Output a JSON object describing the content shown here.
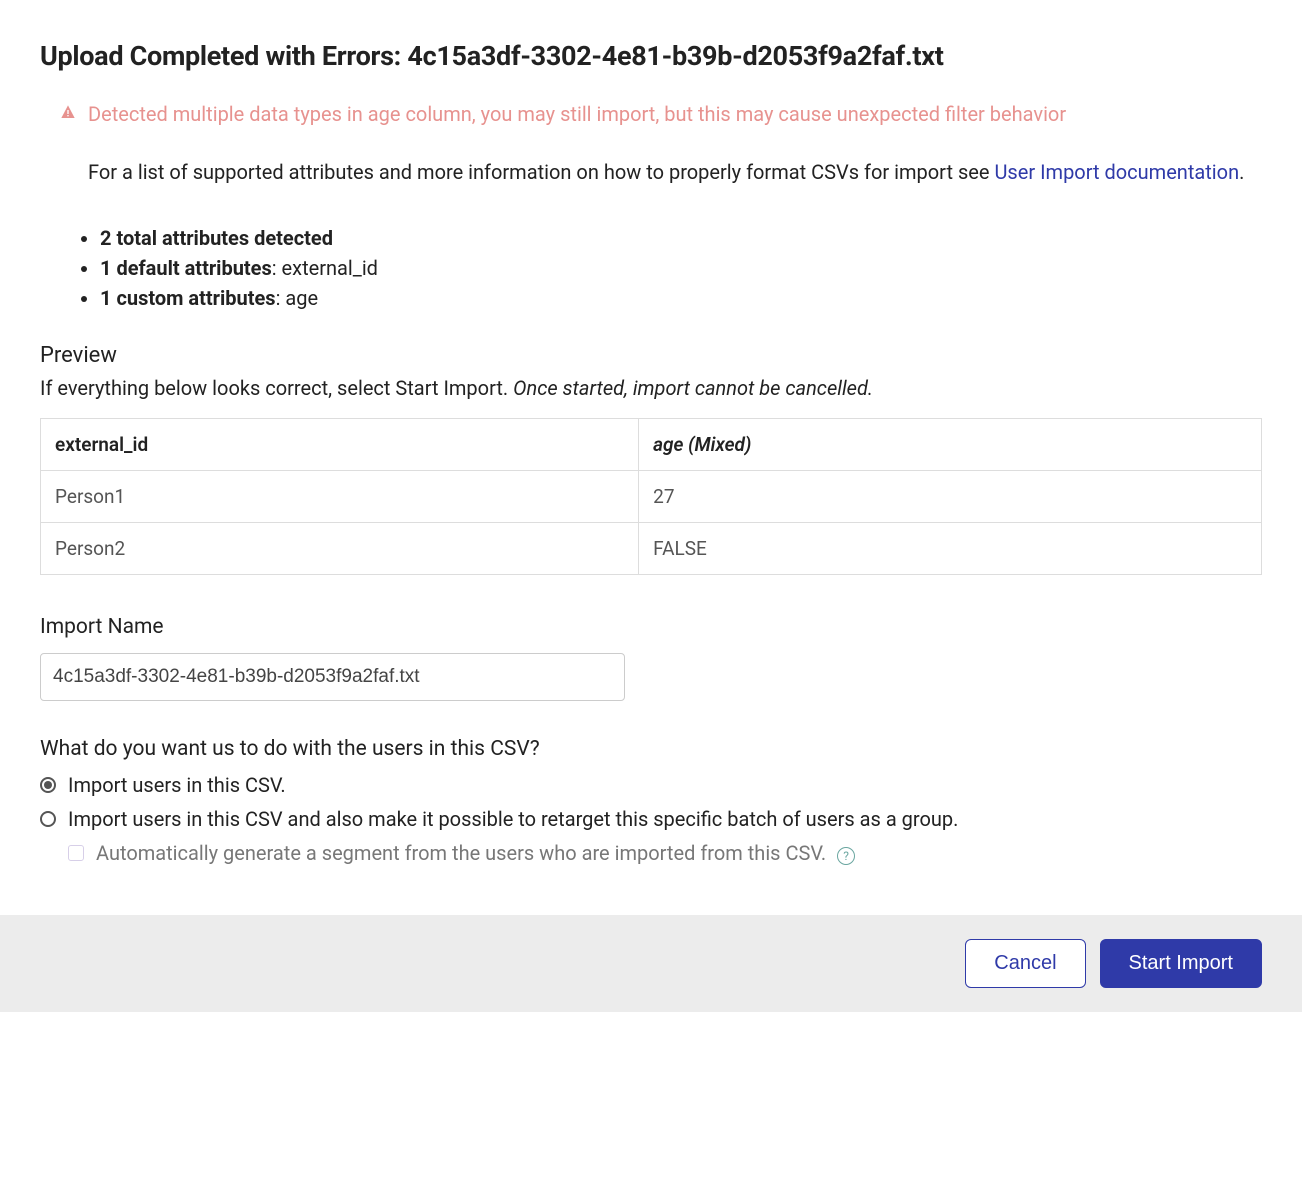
{
  "heading": "Upload Completed with Errors: 4c15a3df-3302-4e81-b39b-d2053f9a2faf.txt",
  "warning": "Detected multiple data types in age column, you may still import, but this may cause unexpected filter behavior",
  "helper_text_pre": "For a list of supported attributes and more information on how to properly format CSVs for import see ",
  "helper_link": "User Import documentation",
  "helper_text_post": ".",
  "bullets": {
    "total": {
      "bold": "2 total attributes detected",
      "rest": ""
    },
    "default": {
      "bold": "1 default attributes",
      "rest": ": external_id"
    },
    "custom": {
      "bold": "1 custom attributes",
      "rest": ": age"
    }
  },
  "preview": {
    "title": "Preview",
    "hint_plain": "If everything below looks correct, select Start Import. ",
    "hint_italic": "Once started, import cannot be cancelled.",
    "columns": [
      "external_id",
      "age (Mixed)"
    ],
    "rows": [
      {
        "external_id": "Person1",
        "age": "27"
      },
      {
        "external_id": "Person2",
        "age": "FALSE"
      }
    ]
  },
  "import_name": {
    "label": "Import Name",
    "value": "4c15a3df-3302-4e81-b39b-d2053f9a2faf.txt"
  },
  "csv_action": {
    "question": "What do you want us to do with the users in this CSV?",
    "option1": "Import users in this CSV.",
    "option2": "Import users in this CSV and also make it possible to retarget this specific batch of users as a group.",
    "checkbox": "Automatically generate a segment from the users who are imported from this CSV."
  },
  "footer": {
    "cancel": "Cancel",
    "start": "Start Import"
  }
}
